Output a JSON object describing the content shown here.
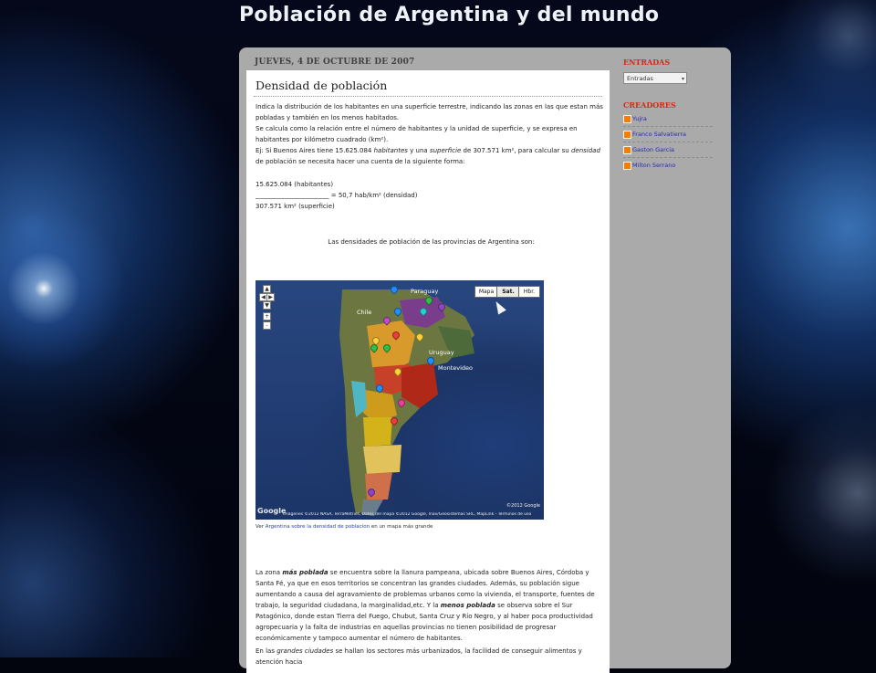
{
  "blog_title": "Población de Argentina y del mundo",
  "post": {
    "date": "Jueves, 4 de Octubre de 2007",
    "title": "Densidad de población",
    "paragraphs": {
      "intro1": "Indica la distribución de los habitantes en una superficie terrestre, indicando las zonas en las que estan más pobladas y también en los menos habitados.",
      "intro2": "Se calcula como la relación entre el número de habitantes y la unidad de superficie, y se expresa en habitantes por kilómetro cuadrado (km²).",
      "ej_part1": "Ej: Si Buenos Aires tiene 15.625.084",
      "ej_habitantes": "habitantes",
      "ej_part2": "y una",
      "ej_superficie": "superficie",
      "ej_part3": "de 307.571 km², para calcular su",
      "ej_densidad": "densidad",
      "ej_part4": "de población se necesita hacer una cuenta de la siguiente forma:",
      "formula_line1": "15.625.084 (habitantes)",
      "formula_line2": "_______________________ = 50,7 hab/km² (densidad)",
      "formula_line3": "307.571 km² (superficie)",
      "provinces_caption": "Las densidades de población de las provincias de Argentina son:"
    },
    "map": {
      "type_buttons": [
        "Mapa",
        "Sat.",
        "Hbr."
      ],
      "active_type": "Sat.",
      "zoom_controls": [
        "+",
        "-"
      ],
      "pan_controls": [
        "▲",
        "◀",
        "▶",
        "▼"
      ],
      "labels": {
        "paraguay": "Paraguay",
        "chile": "Chile",
        "uruguay": "Uruguay",
        "montevideo": "Montevideo"
      },
      "logo": "Google",
      "copyright": "©2012 Google",
      "attribution": "Imágenes ©2012 NASA, TerraMetrics, Datos del mapa ©2012 Google, Inav/Geosistemas SRL, MapLink - Términos de uso"
    },
    "view_larger": {
      "prefix": "Ver",
      "link": "Argentina sobre la densidad de poblacion",
      "suffix": "en un mapa más grande"
    },
    "body1": {
      "p1": "La zona",
      "b1": "más poblada",
      "p2": "se encuentra sobre la llanura pampeana, ubicada sobre Buenos Aires, Córdoba y Santa Fé, ya que en esos territorios se concentran las grandes ciudades. Además, su población sigue aumentando a causa del agravamiento de problemas urbanos como la vivienda, el transporte, fuentes de trabajo, la seguridad ciudadana, la marginalidad,etc. Y la",
      "b2": "menos poblada",
      "p3": "se observa sobre el Sur Patagónico, donde estan Tierra del Fuego, Chubut, Santa Cruz y Río Negro, y al haber poca productividad agropecuaria y la falta de industrias en aquellas provincias no tienen posibilidad de progresar económicamente y tampoco aumentar el número de habitantes."
    },
    "body2": {
      "p1": "En las",
      "i1": "grandes ciudades",
      "p2": "se hallan los sectores más urbanizados, la facilidad de conseguir alimentos y atención hacia"
    }
  },
  "sidebar": {
    "entradas_heading": "ENTRADAS",
    "entradas_select": "Entradas",
    "creadores_heading": "CREADORES",
    "creadores": [
      "Yujra",
      "Franco Salvatierra",
      "Gaston Garcia",
      "Milton Serrano"
    ]
  },
  "colors": {
    "accent_red": "#d6271a",
    "link_blue": "#2828b8",
    "blogger_orange": "#f57d00"
  }
}
